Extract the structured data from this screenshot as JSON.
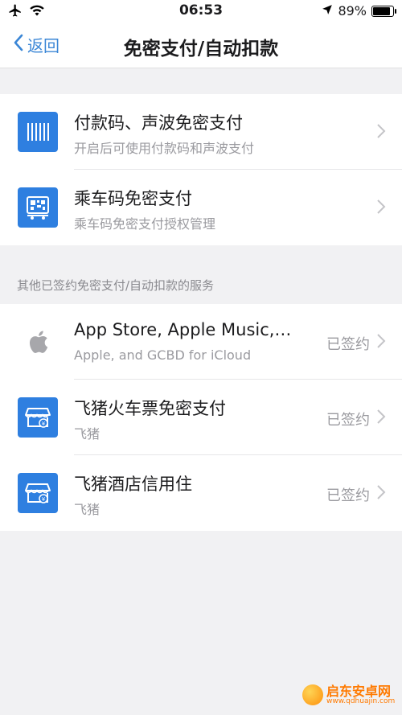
{
  "status_bar": {
    "time": "06:53",
    "battery": "89%",
    "battery_level": 0.89
  },
  "nav": {
    "back_label": "返回",
    "title": "免密支付/自动扣款"
  },
  "primary_items": [
    {
      "title": "付款码、声波免密支付",
      "subtitle": "开启后可使用付款码和声波支付",
      "icon": "barcode-icon"
    },
    {
      "title": "乘车码免密支付",
      "subtitle": "乘车码免密支付授权管理",
      "icon": "bus-code-icon"
    }
  ],
  "section_header": "其他已签约免密支付/自动扣款的服务",
  "services": [
    {
      "title": "App Store, Apple Music,…",
      "subtitle": "Apple, and GCBD for iCloud",
      "status": "已签约",
      "icon": "apple-icon"
    },
    {
      "title": "飞猪火车票免密支付",
      "subtitle": "飞猪",
      "status": "已签约",
      "icon": "fliggy-icon"
    },
    {
      "title": "飞猪酒店信用住",
      "subtitle": "飞猪",
      "status": "已签约",
      "icon": "fliggy-icon"
    }
  ],
  "watermark": {
    "name": "启东安卓网",
    "url": "www.qdhuajin.com"
  },
  "colors": {
    "accent": "#3a86d6",
    "icon_bg": "#2e7fe0",
    "background": "#f1f1f3"
  }
}
